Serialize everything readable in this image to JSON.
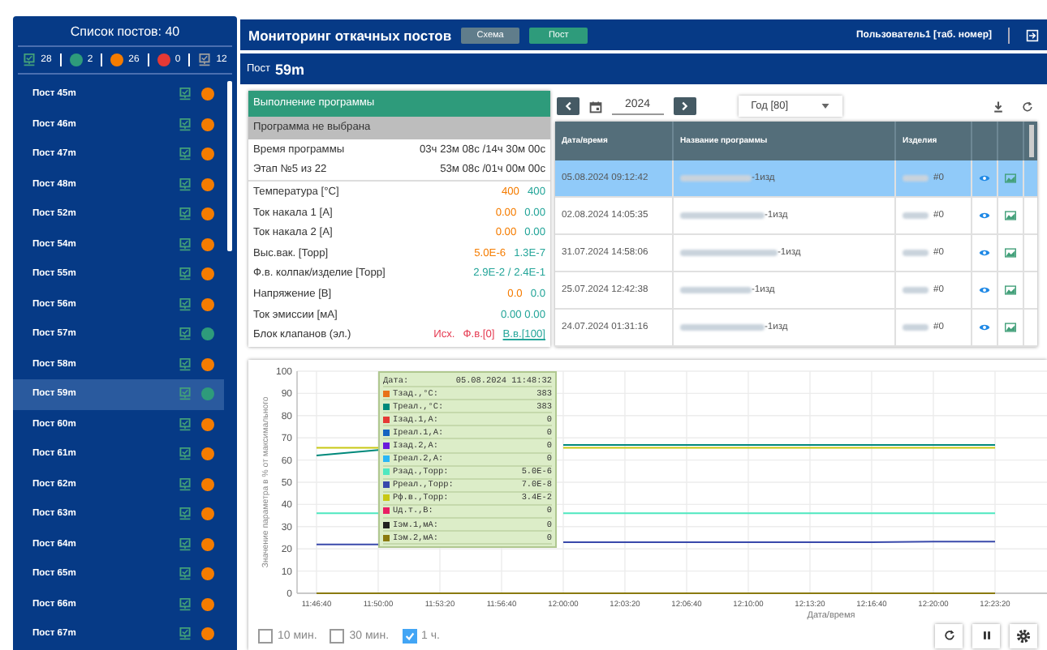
{
  "sidebar": {
    "title": "Список постов: 40",
    "summary": [
      {
        "kind": "monitor",
        "count": "28",
        "color": "#43a07a"
      },
      {
        "kind": "dot",
        "count": "2",
        "color": "#2e9b7b"
      },
      {
        "kind": "dot",
        "count": "26",
        "color": "#f57c00"
      },
      {
        "kind": "dot",
        "count": "0",
        "color": "#e53935"
      },
      {
        "kind": "monitor",
        "count": "12",
        "color": "#9e9e9e"
      }
    ],
    "posts": [
      {
        "name": "Пост 45m",
        "color": "#f57c00",
        "selected": false
      },
      {
        "name": "Пост 46m",
        "color": "#f57c00",
        "selected": false
      },
      {
        "name": "Пост 47m",
        "color": "#f57c00",
        "selected": false
      },
      {
        "name": "Пост 48m",
        "color": "#f57c00",
        "selected": false
      },
      {
        "name": "Пост 52m",
        "color": "#f57c00",
        "selected": false
      },
      {
        "name": "Пост 54m",
        "color": "#f57c00",
        "selected": false
      },
      {
        "name": "Пост 55m",
        "color": "#f57c00",
        "selected": false
      },
      {
        "name": "Пост 56m",
        "color": "#f57c00",
        "selected": false
      },
      {
        "name": "Пост 57m",
        "color": "#2e9b7b",
        "selected": false
      },
      {
        "name": "Пост 58m",
        "color": "#f57c00",
        "selected": false
      },
      {
        "name": "Пост 59m",
        "color": "#2e9b7b",
        "selected": true
      },
      {
        "name": "Пост 60m",
        "color": "#f57c00",
        "selected": false
      },
      {
        "name": "Пост 61m",
        "color": "#f57c00",
        "selected": false
      },
      {
        "name": "Пост 62m",
        "color": "#f57c00",
        "selected": false
      },
      {
        "name": "Пост 63m",
        "color": "#f57c00",
        "selected": false
      },
      {
        "name": "Пост 64m",
        "color": "#f57c00",
        "selected": false
      },
      {
        "name": "Пост 65m",
        "color": "#f57c00",
        "selected": false
      },
      {
        "name": "Пост 66m",
        "color": "#f57c00",
        "selected": false
      },
      {
        "name": "Пост 67m",
        "color": "#f57c00",
        "selected": false
      }
    ]
  },
  "header": {
    "title": "Мониторинг откачных постов",
    "tabs": [
      {
        "label": "Схема",
        "selected": false
      },
      {
        "label": "Пост",
        "selected": true
      }
    ],
    "user": "Пользователь1 [таб. номер]"
  },
  "post": {
    "label": "Пост",
    "name": "59m"
  },
  "program": {
    "title": "Выполнение программы",
    "status": "Программа не выбрана",
    "timing": [
      {
        "label": "Время программы",
        "value": "03ч 23м 08с /14ч 30м 00с"
      },
      {
        "label": "Этап №5 из 22",
        "value": "53м 08с /01ч 00м 00с"
      }
    ],
    "params": [
      {
        "label": "Температура [°С]",
        "values": [
          {
            "text": "400",
            "color": "#f57c00",
            "underlined": false
          },
          {
            "text": "400",
            "color": "#26a69a",
            "underlined": false
          }
        ]
      },
      {
        "label": "Ток накала 1 [А]",
        "values": [
          {
            "text": "0.00",
            "color": "#f57c00",
            "underlined": false
          },
          {
            "text": "0.00",
            "color": "#26a69a",
            "underlined": false
          }
        ]
      },
      {
        "label": "Ток накала 2 [А]",
        "values": [
          {
            "text": "0.00",
            "color": "#f57c00",
            "underlined": false
          },
          {
            "text": "0.00",
            "color": "#26a69a",
            "underlined": false
          }
        ]
      },
      {
        "label": "Выс.вак. [Торр]",
        "values": [
          {
            "text": "5.0E-6",
            "color": "#f57c00",
            "underlined": false
          },
          {
            "text": "1.3E-7",
            "color": "#26a69a",
            "underlined": false
          }
        ]
      },
      {
        "label": "Ф.в. колпак/изделие [Торр]",
        "values": [
          {
            "text": "2.9E-2 / 2.4E-1",
            "color": "#26a69a",
            "underlined": false
          }
        ]
      },
      {
        "label": "Напряжение [В]",
        "values": [
          {
            "text": "0.0",
            "color": "#f57c00",
            "underlined": false
          },
          {
            "text": "0.0",
            "color": "#26a69a",
            "underlined": false
          }
        ]
      },
      {
        "label": "Ток эмиссии [мА]",
        "values": [
          {
            "text": "0.00 0.00",
            "color": "#26a69a",
            "underlined": false
          }
        ]
      },
      {
        "label": "Блок клапанов (эл.)",
        "values": [
          {
            "text": "Исх.",
            "color": "#e53950",
            "underlined": false
          },
          {
            "text": "Ф.в.[0]",
            "color": "#e53950",
            "underlined": false
          },
          {
            "text": "В.в.[100]",
            "color": "#26a69a",
            "underlined": true
          }
        ]
      }
    ]
  },
  "history": {
    "year": "2024",
    "period": "Год [80]",
    "columns": [
      "Дата/время",
      "Название программы",
      "Изделия"
    ],
    "rows": [
      {
        "date": "05.08.2024 09:12:42",
        "program": "-1изд",
        "product": "#0",
        "selected": true
      },
      {
        "date": "02.08.2024 14:05:35",
        "program": "-1изд",
        "product": "#0",
        "selected": false
      },
      {
        "date": "31.07.2024 14:58:06",
        "program": "-1изд",
        "product": "#0",
        "selected": false
      },
      {
        "date": "25.07.2024 12:42:38",
        "program": "-1изд",
        "product": "#0",
        "selected": false
      },
      {
        "date": "24.07.2024 01:31:16",
        "program": "-1изд",
        "product": "#0",
        "selected": false
      }
    ]
  },
  "chart": {
    "chart_data": {
      "type": "line",
      "xlabel": "Дата/время",
      "ylabel": "Значение параметра в % от максимального",
      "grid": true,
      "categories": [
        "11:46:40",
        "11:50:00",
        "11:53:20",
        "11:56:40",
        "12:00:00",
        "12:03:20",
        "12:06:40",
        "12:10:00",
        "12:13:20",
        "12:16:40",
        "12:20:00",
        "12:23:20"
      ],
      "ylim": [
        0,
        100
      ],
      "yticks": [
        0,
        10,
        20,
        30,
        40,
        50,
        60,
        70,
        80,
        90,
        100
      ],
      "series": [
        {
          "color": "#c8c814",
          "values": [
            65.5,
            65.5,
            null,
            null,
            65.5,
            65.5,
            65.5,
            65.5,
            65.5,
            65.5,
            65.5,
            65.5
          ]
        },
        {
          "color": "#00897b",
          "values": [
            62,
            64.5,
            null,
            null,
            66.8,
            66.8,
            66.8,
            66.8,
            66.8,
            66.8,
            66.8,
            66.8
          ]
        },
        {
          "color": "#4ee8c0",
          "values": [
            36,
            36,
            null,
            null,
            36,
            36,
            36,
            36,
            36,
            36,
            36,
            36
          ]
        },
        {
          "color": "#3949ab",
          "values": [
            22,
            22,
            null,
            null,
            23,
            23,
            23,
            23,
            23,
            23,
            23.3,
            23.3
          ]
        },
        {
          "color": "#8a7a10",
          "values": [
            0,
            0,
            0,
            0,
            0,
            0,
            0,
            0,
            0,
            0,
            0,
            0
          ]
        }
      ]
    },
    "tooltip": {
      "label": "Дата:",
      "date": "05.08.2024 11:48:32",
      "items": [
        {
          "label": "Тзад.,°С:",
          "value": "383",
          "color": "#e8711a"
        },
        {
          "label": "Треал.,°С:",
          "value": "383",
          "color": "#00897b"
        },
        {
          "label": "Iзад.1,А:",
          "value": "0",
          "color": "#e53935"
        },
        {
          "label": "Iреал.1,А:",
          "value": "0",
          "color": "#1565c0"
        },
        {
          "label": "Iзад.2,А:",
          "value": "0",
          "color": "#6a1bdc"
        },
        {
          "label": "Iреал.2,А:",
          "value": "0",
          "color": "#29b6f6"
        },
        {
          "label": "Рзад.,Торр:",
          "value": "5.0E-6",
          "color": "#4ee8c0"
        },
        {
          "label": "Рреал.,Торр:",
          "value": "7.0E-8",
          "color": "#3949ab"
        },
        {
          "label": "Рф.в.,Торр:",
          "value": "3.4E-2",
          "color": "#c8c814"
        },
        {
          "label": "Uд.т.,В:",
          "value": "0",
          "color": "#e91e63"
        },
        {
          "label": "Iэм.1,мА:",
          "value": "0",
          "color": "#212121"
        },
        {
          "label": "Iэм.2,мА:",
          "value": "0",
          "color": "#8a7a10"
        }
      ]
    },
    "ranges": [
      {
        "label": "10 мин.",
        "checked": false
      },
      {
        "label": "30 мин.",
        "checked": false
      },
      {
        "label": "1 ч.",
        "checked": true
      }
    ]
  }
}
